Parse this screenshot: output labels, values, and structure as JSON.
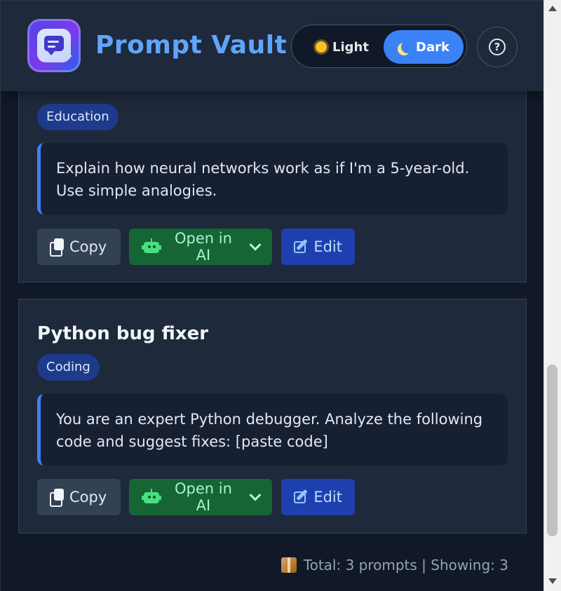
{
  "app": {
    "title": "Prompt Vault",
    "theme": {
      "light_label": "Light",
      "dark_label": "Dark",
      "selected": "Dark"
    },
    "help_label": "?"
  },
  "prompts": [
    {
      "title": "",
      "tag": "Education",
      "text": "Explain how neural networks work as if I'm a 5-year-old. Use simple analogies.",
      "actions": {
        "copy": "Copy",
        "open_ai": "Open in AI",
        "edit": "Edit"
      }
    },
    {
      "title": "Python bug fixer",
      "tag": "Coding",
      "text": "You are an expert Python debugger. Analyze the following code and suggest fixes: [paste code]",
      "actions": {
        "copy": "Copy",
        "open_ai": "Open in AI",
        "edit": "Edit"
      }
    }
  ],
  "footer": {
    "text": "Total: 3 prompts | Showing: 3",
    "icon": "package-icon"
  },
  "colors": {
    "accent": "#3b82f6",
    "title": "#60a5fa",
    "background": "#111827",
    "card": "#1e293b",
    "success": "#166534"
  },
  "icons": {
    "logo": "prompt-vault-logo",
    "light": "sun-icon",
    "dark": "moon-icon",
    "help": "question-circle-icon",
    "copy": "copy-icon",
    "open_ai": "robot-icon",
    "dropdown": "chevron-down-icon",
    "edit": "edit-icon"
  }
}
